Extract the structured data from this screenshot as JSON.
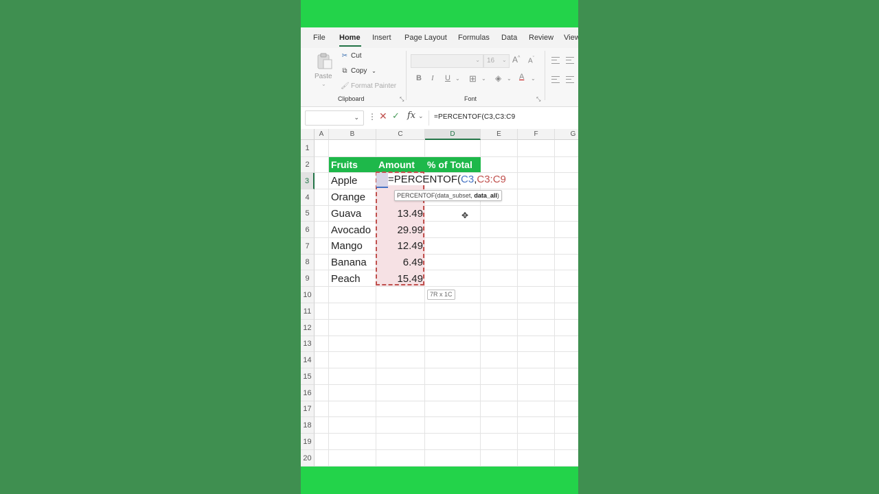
{
  "ribbon_tabs": [
    "File",
    "Home",
    "Insert",
    "Page Layout",
    "Formulas",
    "Data",
    "Review",
    "View"
  ],
  "clipboard": {
    "paste": "Paste",
    "cut": "Cut",
    "copy": "Copy",
    "format_painter": "Format Painter",
    "group_label": "Clipboard"
  },
  "font_group": {
    "font_size": "16",
    "bold": "B",
    "italic": "I",
    "underline": "U",
    "grow": "A",
    "shrink": "A",
    "font_color_letter": "A",
    "group_label": "Font"
  },
  "formula_bar": {
    "formula": "=PERCENTOF(C3,C3:C9"
  },
  "columns": [
    "A",
    "B",
    "C",
    "D",
    "E",
    "F",
    "G"
  ],
  "rows": [
    "1",
    "2",
    "3",
    "4",
    "5",
    "6",
    "7",
    "8",
    "9",
    "10",
    "11",
    "12",
    "13",
    "14",
    "15",
    "16",
    "17",
    "18",
    "19",
    "20"
  ],
  "table": {
    "headers": [
      "Fruits",
      "Amount",
      "% of Total"
    ],
    "fruits": [
      "Apple",
      "Orange",
      "Guava",
      "Avocado",
      "Mango",
      "Banana",
      "Peach"
    ],
    "amounts": [
      "13.49",
      "29.99",
      "12.49",
      "6.49",
      "15.49"
    ]
  },
  "edit": {
    "prefix": "=PERCENTOF(",
    "ref1": "C3",
    "comma": ",",
    "ref2": "C3:C9"
  },
  "tooltip": {
    "text": "PERCENTOF(data_subset, ",
    "bold": "data_all",
    "close": ")"
  },
  "range_size": "7R x 1C",
  "colors": {
    "brand_green": "#23d34a",
    "header_green": "#1eb84a",
    "excel_green": "#217346",
    "ref_blue": "#4472c4",
    "ref_red": "#c0504d"
  }
}
